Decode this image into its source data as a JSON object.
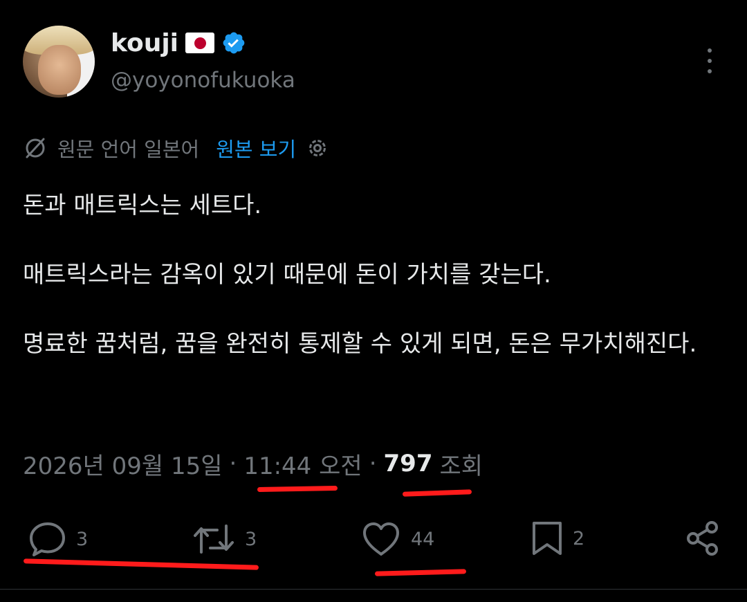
{
  "author": {
    "name": "kouji",
    "handle": "@yoyonofukuoka",
    "verified": true,
    "flag_icon": "japan-flag-icon"
  },
  "translation": {
    "label": "원문 언어 일본어",
    "link": "원본 보기"
  },
  "tweet": {
    "paragraphs": [
      "돈과 매트릭스는 세트다.",
      "매트릭스라는 감옥이 있기 때문에 돈이 가치를 갖는다.",
      "명료한 꿈처럼, 꿈을 완전히 통제할 수 있게 되면, 돈은 무가치해진다."
    ]
  },
  "meta": {
    "date": "2026년 09월 15일",
    "separator": "·",
    "time": "11:44 오전",
    "views": "797",
    "views_label": "조회"
  },
  "actions": {
    "replies": "3",
    "retweets": "3",
    "likes": "44",
    "bookmarks": "2"
  },
  "colors": {
    "background": "#000000",
    "text": "#e7e9ea",
    "muted": "#71767b",
    "link": "#1d9bf0",
    "annotation": "#ff1b1b"
  }
}
